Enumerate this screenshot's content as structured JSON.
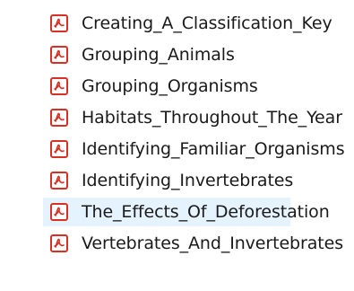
{
  "file_list": {
    "icon": "pdf-file-icon",
    "accent_color": "#d93025",
    "selected_index": 6,
    "items": [
      {
        "name": "Creating_A_Classification_Key"
      },
      {
        "name": "Grouping_Animals"
      },
      {
        "name": "Grouping_Organisms"
      },
      {
        "name": "Habitats_Throughout_The_Year"
      },
      {
        "name": "Identifying_Familiar_Organisms"
      },
      {
        "name": "Identifying_Invertebrates"
      },
      {
        "name": "The_Effects_Of_Deforestation"
      },
      {
        "name": "Vertebrates_And_Invertebrates"
      }
    ]
  }
}
